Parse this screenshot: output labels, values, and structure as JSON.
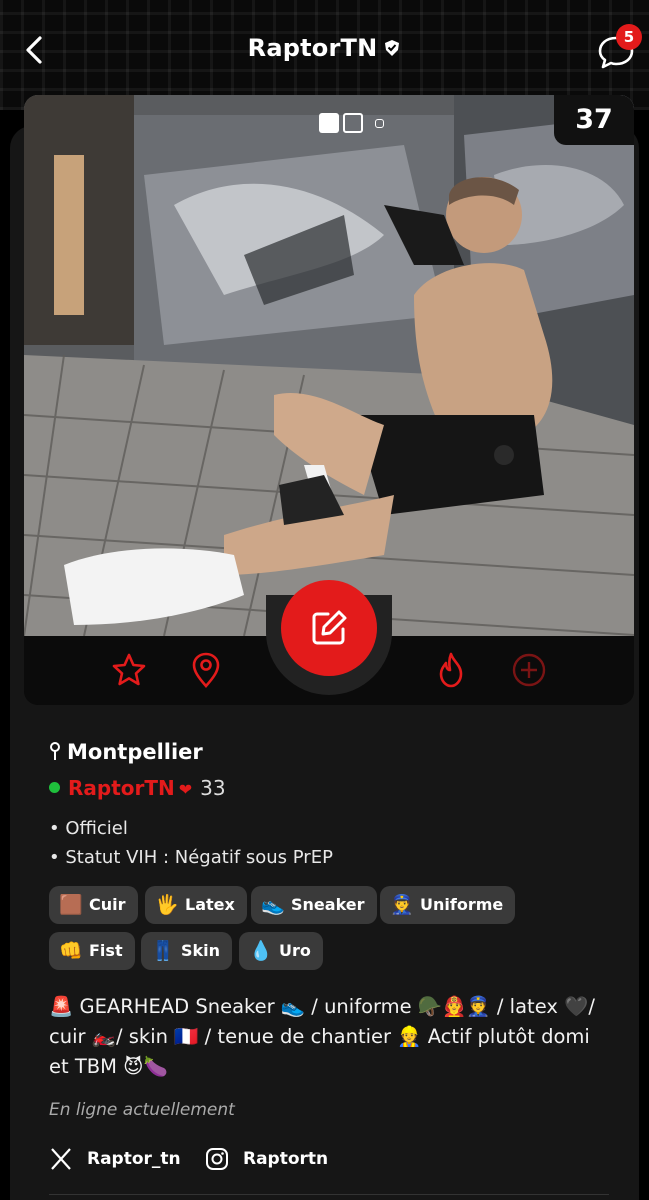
{
  "header": {
    "title": "RaptorTN",
    "unread_count": "5"
  },
  "photo": {
    "age": "37",
    "pager": {
      "count": 3,
      "active_index": 0
    }
  },
  "profile": {
    "location": "Montpellier",
    "username": "RaptorTN",
    "age": "33",
    "bullets": [
      "• Officiel",
      "• Statut VIH : Négatif sous PrEP"
    ]
  },
  "tags": [
    {
      "icon": "🟫",
      "label": "Cuir"
    },
    {
      "icon": "🖐",
      "label": "Latex"
    },
    {
      "icon": "👟",
      "label": "Sneaker"
    },
    {
      "icon": "👮",
      "label": "Uniforme"
    },
    {
      "icon": "👊",
      "label": "Fist"
    },
    {
      "icon": "👖",
      "label": "Skin"
    },
    {
      "icon": "💧",
      "label": "Uro"
    }
  ],
  "bio": "🚨 GEARHEAD Sneaker 👟 / uniforme 🪖👨‍🚒👮 / latex 🖤/ cuir 🏍️/ skin 🇫🇷 / tenue de chantier 👷 Actif plutôt domi et TBM 😈🍆",
  "status_text": "En ligne actuellement",
  "socials": [
    {
      "network": "x-icon",
      "handle": "Raptor_tn"
    },
    {
      "network": "instagram-icon",
      "handle": "Raptortn"
    }
  ],
  "colors": {
    "accent": "#e31b1b",
    "online": "#1fbf3c",
    "tag_bg": "#3a3a3a"
  }
}
